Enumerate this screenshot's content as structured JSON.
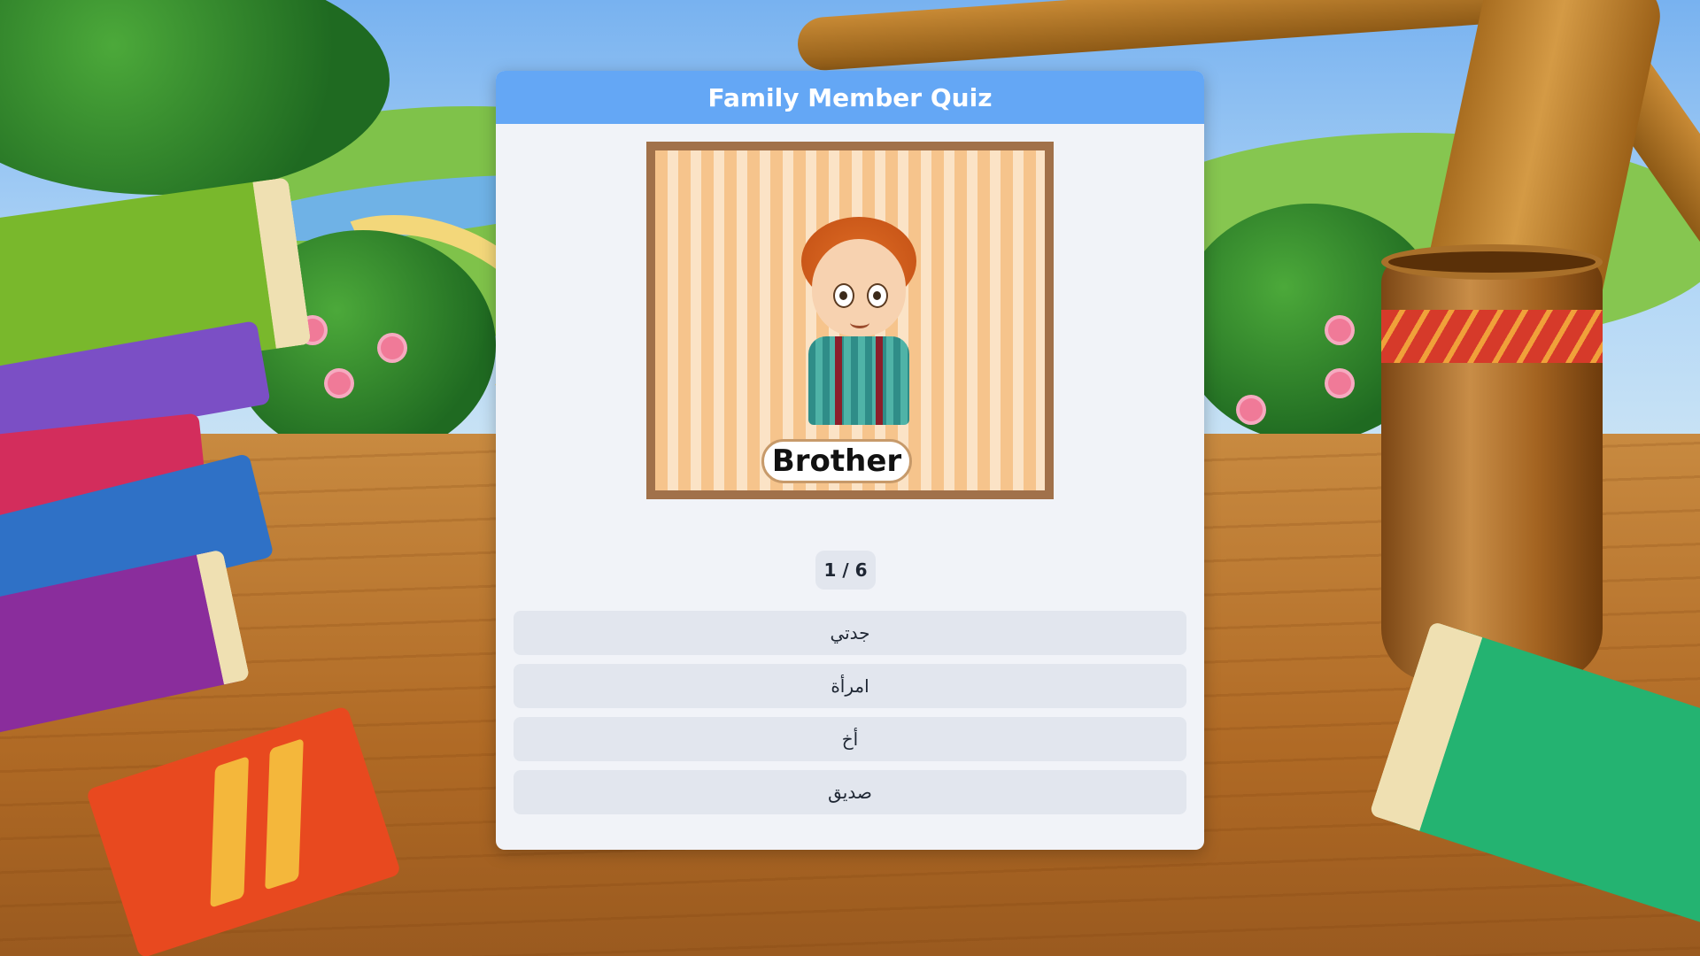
{
  "quiz": {
    "title": "Family Member Quiz",
    "picture_label": "Brother",
    "progress": "1 / 6",
    "options": [
      "جدتي",
      "امرأة",
      "أخ",
      "صديق"
    ]
  },
  "colors": {
    "header": "#64a7f5",
    "card": "#f1f3f8",
    "option": "#e2e6ee",
    "frame": "#a1714a"
  }
}
